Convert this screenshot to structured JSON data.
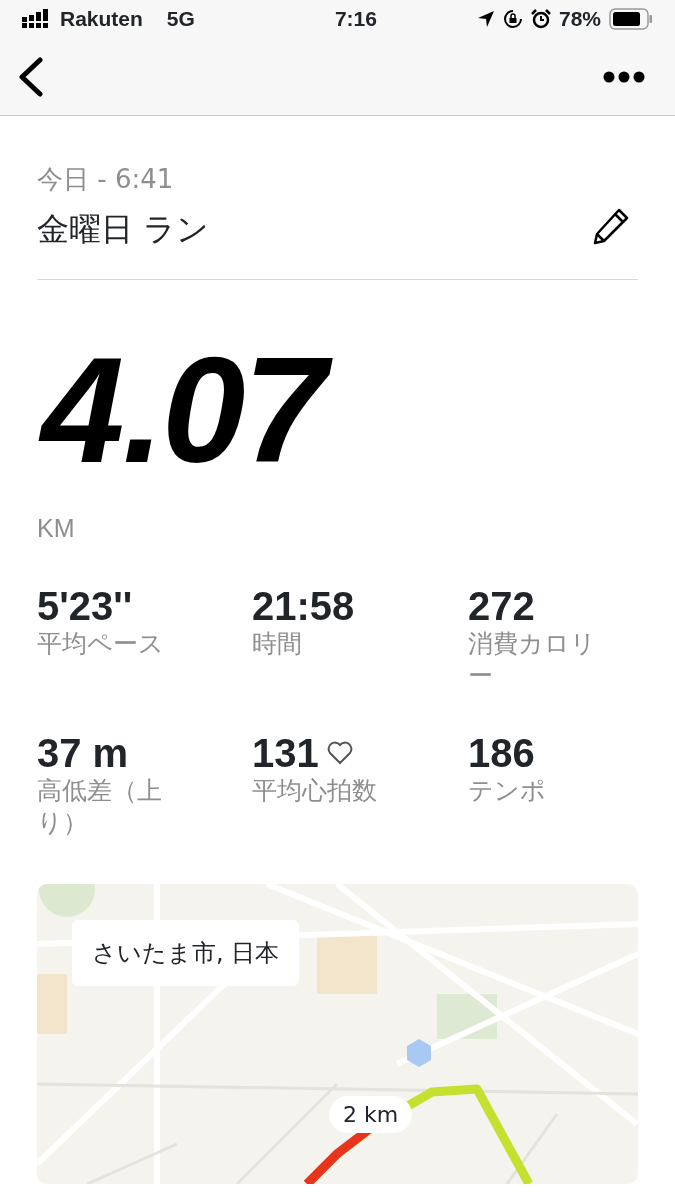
{
  "status_bar": {
    "carrier": "Rakuten",
    "network": "5G",
    "time": "7:16",
    "battery": "78%"
  },
  "activity": {
    "date": "今日 - 6:41",
    "title": "金曜日 ラン"
  },
  "distance": {
    "value": "4.07",
    "unit": "KM"
  },
  "stats": [
    {
      "value": "5'23''",
      "label": "平均ペース",
      "heart": false
    },
    {
      "value": "21:58",
      "label": "時間",
      "heart": false
    },
    {
      "value": "272",
      "label": "消費カロリー",
      "heart": false
    },
    {
      "value": "37 m",
      "label": "高低差（上り）",
      "heart": false
    },
    {
      "value": "131",
      "label": "平均心拍数",
      "heart": true
    },
    {
      "value": "186",
      "label": "テンポ",
      "heart": false
    }
  ],
  "map": {
    "kind": "picture",
    "location": "さいたま市, 日本",
    "marker": "2 km"
  }
}
